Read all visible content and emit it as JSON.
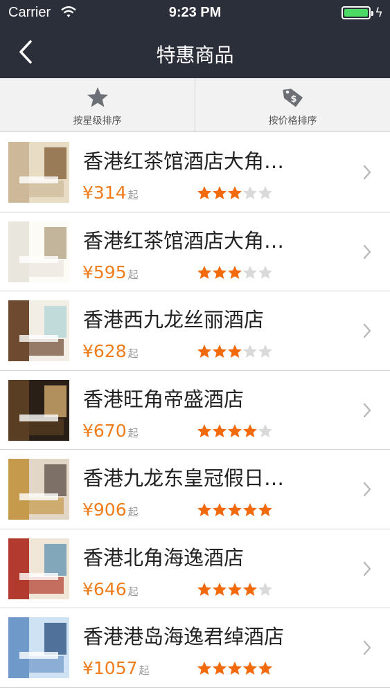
{
  "status": {
    "carrier": "Carrier",
    "time": "9:23 PM"
  },
  "nav": {
    "title": "特惠商品"
  },
  "sort": [
    {
      "label": "按星级排序",
      "icon": "star-icon"
    },
    {
      "label": "按价格排序",
      "icon": "price-tag-icon"
    }
  ],
  "colors": {
    "accent": "#f07c1c",
    "star_on": "#f26a0c",
    "star_off": "#d9d9d9",
    "nav_bg": "#2b2f3a"
  },
  "hotels": [
    {
      "name": "香港红茶馆酒店大角…",
      "price": "¥314",
      "unit": "起",
      "stars": 3,
      "thumb": "hotel-photo-1"
    },
    {
      "name": "香港红茶馆酒店大角…",
      "price": "¥595",
      "unit": "起",
      "stars": 3,
      "thumb": "hotel-photo-2"
    },
    {
      "name": "香港西九龙丝丽酒店",
      "price": "¥628",
      "unit": "起",
      "stars": 3,
      "thumb": "hotel-photo-3"
    },
    {
      "name": "香港旺角帝盛酒店",
      "price": "¥670",
      "unit": "起",
      "stars": 4,
      "thumb": "hotel-photo-4"
    },
    {
      "name": "香港九龙东皇冠假日…",
      "price": "¥906",
      "unit": "起",
      "stars": 5,
      "thumb": "hotel-photo-5"
    },
    {
      "name": "香港北角海逸酒店",
      "price": "¥646",
      "unit": "起",
      "stars": 4,
      "thumb": "hotel-photo-6"
    },
    {
      "name": "香港港岛海逸君绰酒店",
      "price": "¥1057",
      "unit": "起",
      "stars": 5,
      "thumb": "hotel-photo-7"
    }
  ]
}
